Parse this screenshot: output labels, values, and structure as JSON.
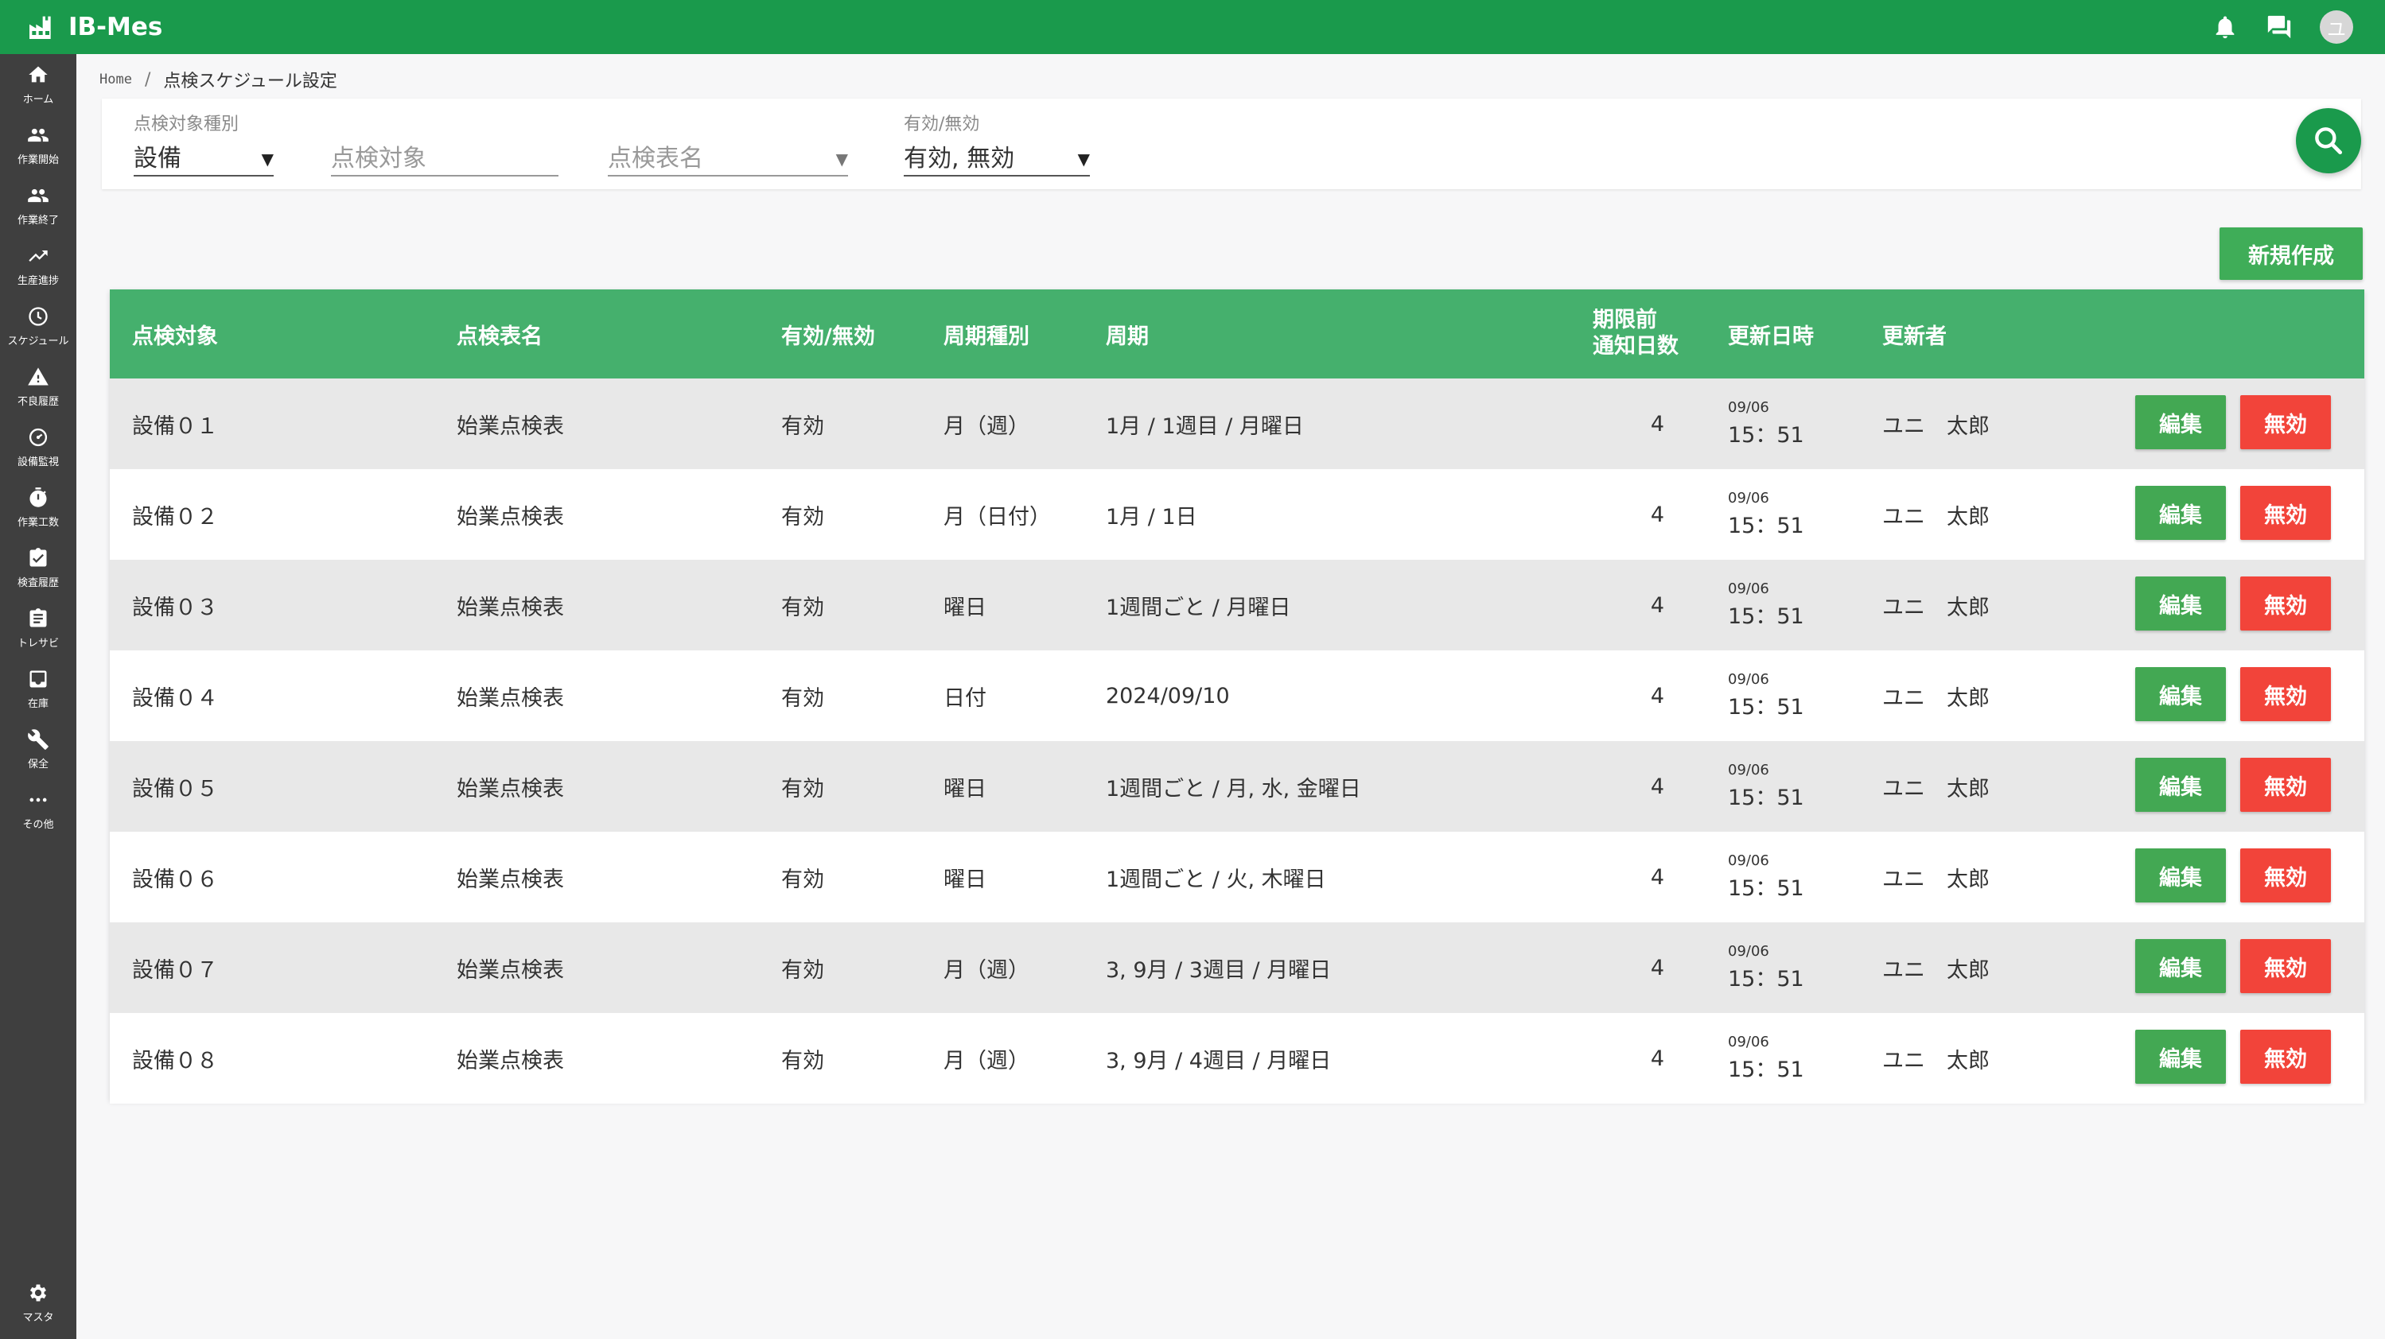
{
  "app": {
    "title": "IB-Mes"
  },
  "header": {
    "avatar_initial": "ユ"
  },
  "sidebar": {
    "items": [
      {
        "label": "ホーム",
        "icon": "home-icon"
      },
      {
        "label": "作業開始",
        "icon": "people-icon"
      },
      {
        "label": "作業終了",
        "icon": "people-icon"
      },
      {
        "label": "生産進捗",
        "icon": "trending-up-icon"
      },
      {
        "label": "スケジュール",
        "icon": "clock-icon"
      },
      {
        "label": "不良履歴",
        "icon": "warning-icon"
      },
      {
        "label": "設備監視",
        "icon": "gauge-icon"
      },
      {
        "label": "作業工数",
        "icon": "stopwatch-icon"
      },
      {
        "label": "検査履歴",
        "icon": "clipboard-check-icon"
      },
      {
        "label": "トレサビ",
        "icon": "clipboard-icon"
      },
      {
        "label": "在庫",
        "icon": "inbox-icon"
      },
      {
        "label": "保全",
        "icon": "wrench-icon"
      },
      {
        "label": "その他",
        "icon": "more-icon"
      }
    ],
    "bottom": {
      "label": "マスタ",
      "icon": "gear-icon"
    }
  },
  "breadcrumb": {
    "home": "Home",
    "separator": "/",
    "current": "点検スケジュール設定"
  },
  "filters": {
    "target_type": {
      "label": "点検対象種別",
      "value": "設備"
    },
    "target": {
      "placeholder": "点検対象"
    },
    "sheet_name": {
      "placeholder": "点検表名"
    },
    "validity": {
      "label": "有効/無効",
      "value": "有効, 無効"
    }
  },
  "toolbar": {
    "new_label": "新規作成"
  },
  "table": {
    "headers": {
      "target": "点検対象",
      "sheet": "点検表名",
      "validity": "有効/無効",
      "cycle_type": "周期種別",
      "cycle": "周期",
      "notice_line1": "期限前",
      "notice_line2": "通知日数",
      "updated_at": "更新日時",
      "updater": "更新者"
    },
    "edit_label": "編集",
    "invalid_label": "無効",
    "rows": [
      {
        "target": "設備０１",
        "sheet": "始業点検表",
        "validity": "有効",
        "cycle_type": "月（週）",
        "cycle": "1月 / 1週目 / 月曜日",
        "notice": "4",
        "date": "09/06",
        "time": "15：51",
        "updater": "ユニ　太郎"
      },
      {
        "target": "設備０２",
        "sheet": "始業点検表",
        "validity": "有効",
        "cycle_type": "月（日付）",
        "cycle": "1月 / 1日",
        "notice": "4",
        "date": "09/06",
        "time": "15：51",
        "updater": "ユニ　太郎"
      },
      {
        "target": "設備０３",
        "sheet": "始業点検表",
        "validity": "有効",
        "cycle_type": "曜日",
        "cycle": "1週間ごと / 月曜日",
        "notice": "4",
        "date": "09/06",
        "time": "15：51",
        "updater": "ユニ　太郎"
      },
      {
        "target": "設備０４",
        "sheet": "始業点検表",
        "validity": "有効",
        "cycle_type": "日付",
        "cycle": "2024/09/10",
        "notice": "4",
        "date": "09/06",
        "time": "15：51",
        "updater": "ユニ　太郎"
      },
      {
        "target": "設備０５",
        "sheet": "始業点検表",
        "validity": "有効",
        "cycle_type": "曜日",
        "cycle": "1週間ごと / 月, 水, 金曜日",
        "notice": "4",
        "date": "09/06",
        "time": "15：51",
        "updater": "ユニ　太郎"
      },
      {
        "target": "設備０６",
        "sheet": "始業点検表",
        "validity": "有効",
        "cycle_type": "曜日",
        "cycle": "1週間ごと / 火, 木曜日",
        "notice": "4",
        "date": "09/06",
        "time": "15：51",
        "updater": "ユニ　太郎"
      },
      {
        "target": "設備０７",
        "sheet": "始業点検表",
        "validity": "有効",
        "cycle_type": "月（週）",
        "cycle": "3, 9月 / 3週目 / 月曜日",
        "notice": "4",
        "date": "09/06",
        "time": "15：51",
        "updater": "ユニ　太郎"
      },
      {
        "target": "設備０８",
        "sheet": "始業点検表",
        "validity": "有効",
        "cycle_type": "月（週）",
        "cycle": "3, 9月 / 4週目 / 月曜日",
        "notice": "4",
        "date": "09/06",
        "time": "15：51",
        "updater": "ユニ　太郎"
      }
    ]
  },
  "colors": {
    "brand": "#1a9a4c",
    "table_header": "#45b06d",
    "edit_button": "#43a853",
    "invalid_button": "#f2443a",
    "sidebar": "#3f3f3f"
  }
}
